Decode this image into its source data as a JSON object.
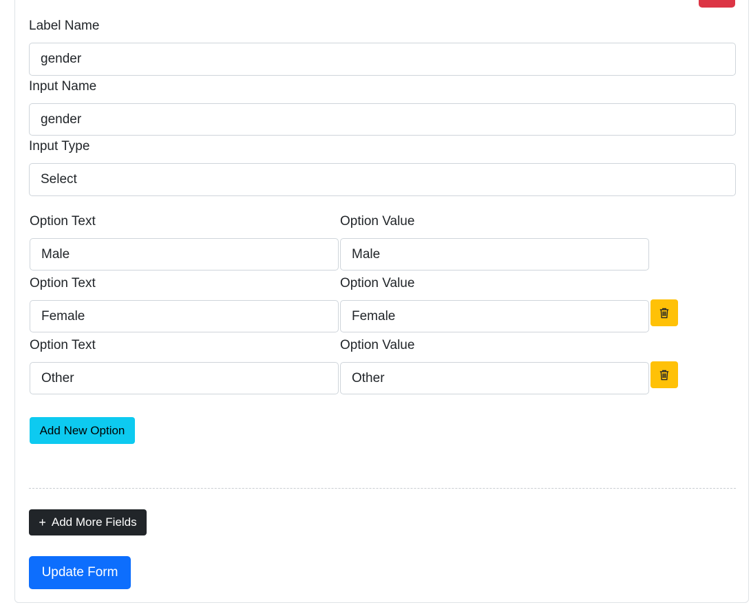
{
  "field": {
    "label_name": {
      "label": "Label Name",
      "value": "gender"
    },
    "input_name": {
      "label": "Input Name",
      "value": "gender"
    },
    "input_type": {
      "label": "Input Type",
      "value": "Select"
    }
  },
  "options": [
    {
      "text_label": "Option Text",
      "value_label": "Option Value",
      "text": "Male",
      "value": "Male",
      "deletable": false
    },
    {
      "text_label": "Option Text",
      "value_label": "Option Value",
      "text": "Female",
      "value": "Female",
      "deletable": true
    },
    {
      "text_label": "Option Text",
      "value_label": "Option Value",
      "text": "Other",
      "value": "Other",
      "deletable": true
    }
  ],
  "buttons": {
    "add_option": "Add New Option",
    "add_fields_icon": "+",
    "add_fields": "Add More Fields",
    "update_form": "Update Form"
  },
  "icons": {
    "delete_option": "trash-icon",
    "remove_field": "remove-field-button"
  },
  "colors": {
    "danger": "#dc3545",
    "warning": "#ffc107",
    "info": "#0dcaf0",
    "dark": "#212529",
    "primary": "#0d6efd"
  }
}
